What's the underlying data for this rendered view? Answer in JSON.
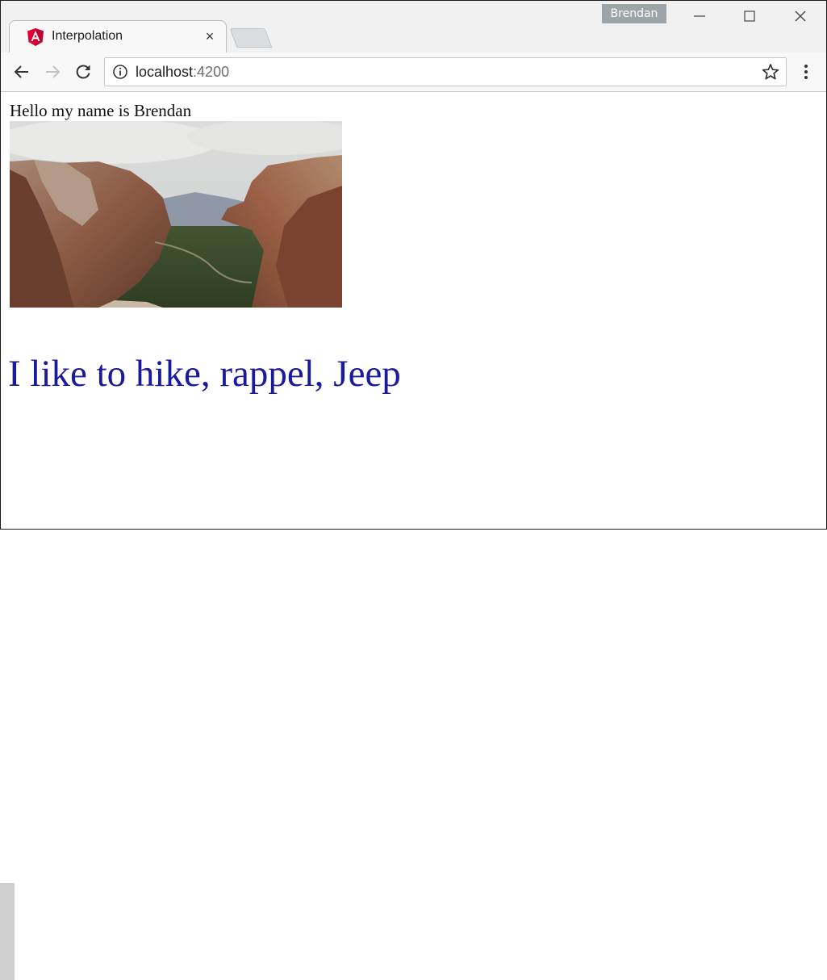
{
  "browser": {
    "tab_title": "Interpolation",
    "tab_close": "×",
    "profile_name": "Brendan",
    "url_host": "localhost",
    "url_port": ":4200"
  },
  "page": {
    "greeting": "Hello my name is Brendan",
    "hobbies": "I like to hike, rappel, Jeep"
  },
  "icons": {
    "favicon": "angular-icon",
    "back": "arrow-left-icon",
    "forward": "arrow-right-icon",
    "reload": "reload-icon",
    "info": "info-icon",
    "bookmark": "star-icon",
    "menu": "kebab-menu-icon",
    "minimize": "minimize-icon",
    "maximize": "maximize-icon",
    "close": "close-icon"
  },
  "colors": {
    "hobbies_text": "#1a1a9c",
    "angular_red": "#dd0031",
    "profile_badge": "#9ea5a8"
  }
}
